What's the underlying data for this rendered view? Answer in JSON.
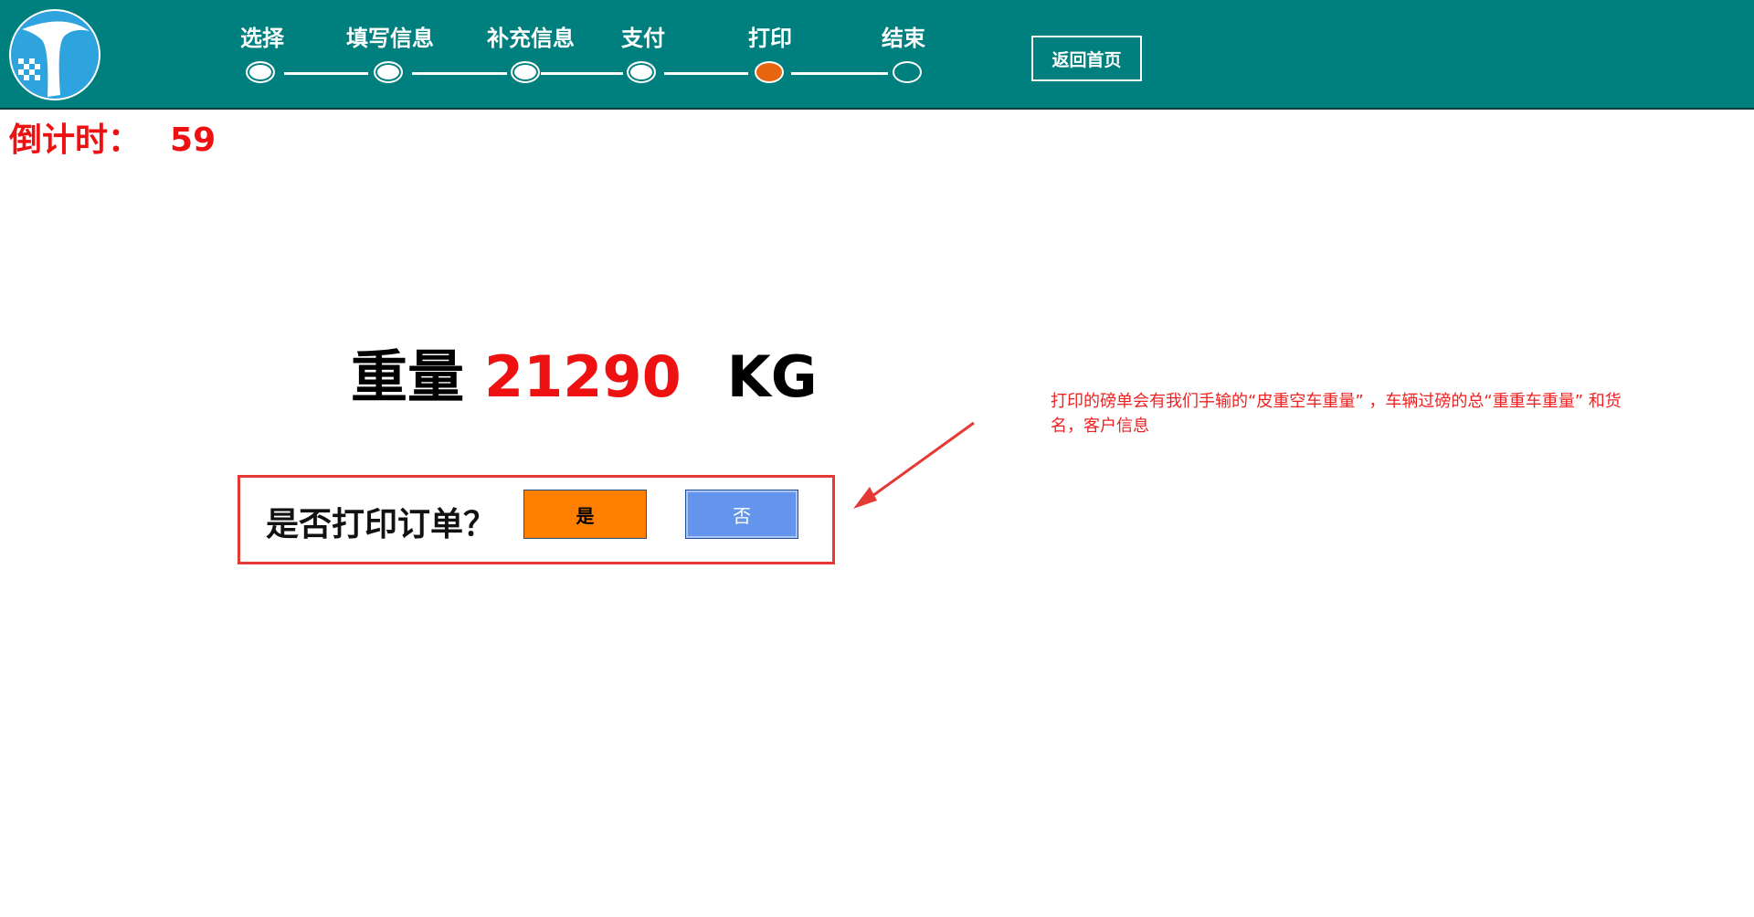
{
  "header": {
    "logo_icon": "road-logo-icon",
    "steps": [
      {
        "label": "选择",
        "state": "done"
      },
      {
        "label": "填写信息",
        "state": "done"
      },
      {
        "label": "补充信息",
        "state": "done"
      },
      {
        "label": "支付",
        "state": "done"
      },
      {
        "label": "打印",
        "state": "current"
      },
      {
        "label": "结束",
        "state": "todo"
      }
    ],
    "home_button": "返回首页"
  },
  "countdown": {
    "label": "倒计时：",
    "value": "59"
  },
  "weight": {
    "label": "重量",
    "value": "21290",
    "unit": "KG"
  },
  "confirm": {
    "question": "是否打印订单？",
    "yes_label": "是",
    "no_label": "否"
  },
  "annotation": {
    "text": "打印的磅单会有我们手输的“皮重空车重量” ，车辆过磅的总“重重车重量” 和货名，客户信息"
  },
  "colors": {
    "header_bg": "#007f7f",
    "current_step": "#e8650f",
    "accent_red": "#ee1111",
    "yes_button": "#ff8000",
    "no_button": "#6495ed"
  }
}
